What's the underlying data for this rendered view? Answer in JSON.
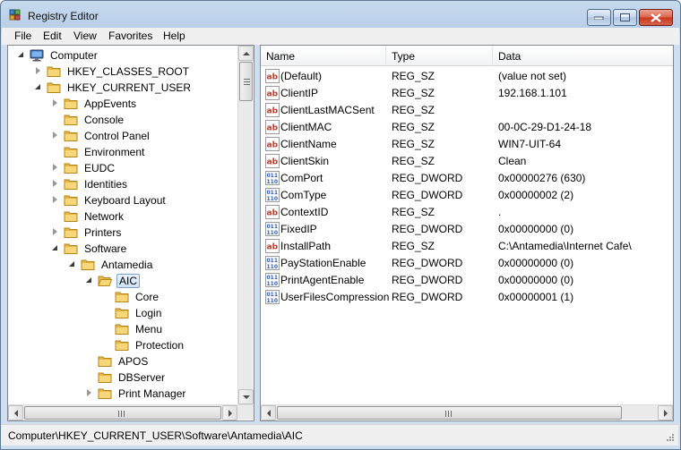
{
  "window": {
    "title": "Registry Editor"
  },
  "menu": [
    "File",
    "Edit",
    "View",
    "Favorites",
    "Help"
  ],
  "tree": [
    {
      "label": "Computer",
      "level": 0,
      "state": "open",
      "icon": "computer-icon"
    },
    {
      "label": "HKEY_CLASSES_ROOT",
      "level": 1,
      "state": "closed",
      "icon": "folder-icon"
    },
    {
      "label": "HKEY_CURRENT_USER",
      "level": 1,
      "state": "open",
      "icon": "folder-icon"
    },
    {
      "label": "AppEvents",
      "level": 2,
      "state": "closed",
      "icon": "folder-icon"
    },
    {
      "label": "Console",
      "level": 2,
      "state": "none",
      "icon": "folder-icon"
    },
    {
      "label": "Control Panel",
      "level": 2,
      "state": "closed",
      "icon": "folder-icon"
    },
    {
      "label": "Environment",
      "level": 2,
      "state": "none",
      "icon": "folder-icon"
    },
    {
      "label": "EUDC",
      "level": 2,
      "state": "closed",
      "icon": "folder-icon"
    },
    {
      "label": "Identities",
      "level": 2,
      "state": "closed",
      "icon": "folder-icon"
    },
    {
      "label": "Keyboard Layout",
      "level": 2,
      "state": "closed",
      "icon": "folder-icon"
    },
    {
      "label": "Network",
      "level": 2,
      "state": "none",
      "icon": "folder-icon"
    },
    {
      "label": "Printers",
      "level": 2,
      "state": "closed",
      "icon": "folder-icon"
    },
    {
      "label": "Software",
      "level": 2,
      "state": "open",
      "icon": "folder-icon"
    },
    {
      "label": "Antamedia",
      "level": 3,
      "state": "open",
      "icon": "folder-icon"
    },
    {
      "label": "AIC",
      "level": 4,
      "state": "open",
      "icon": "folder-open-icon",
      "selected": true
    },
    {
      "label": "Core",
      "level": 5,
      "state": "none",
      "icon": "folder-icon"
    },
    {
      "label": "Login",
      "level": 5,
      "state": "none",
      "icon": "folder-icon"
    },
    {
      "label": "Menu",
      "level": 5,
      "state": "none",
      "icon": "folder-icon"
    },
    {
      "label": "Protection",
      "level": 5,
      "state": "none",
      "icon": "folder-icon"
    },
    {
      "label": "APOS",
      "level": 4,
      "state": "none",
      "icon": "folder-icon"
    },
    {
      "label": "DBServer",
      "level": 4,
      "state": "none",
      "icon": "folder-icon"
    },
    {
      "label": "Print Manager",
      "level": 4,
      "state": "closed",
      "icon": "folder-icon"
    }
  ],
  "list": {
    "columns": [
      "Name",
      "Type",
      "Data"
    ],
    "rows": [
      {
        "icon": "string-value-icon",
        "name": "(Default)",
        "type": "REG_SZ",
        "data": "(value not set)"
      },
      {
        "icon": "string-value-icon",
        "name": "ClientIP",
        "type": "REG_SZ",
        "data": "192.168.1.101"
      },
      {
        "icon": "string-value-icon",
        "name": "ClientLastMACSent",
        "type": "REG_SZ",
        "data": ""
      },
      {
        "icon": "string-value-icon",
        "name": "ClientMAC",
        "type": "REG_SZ",
        "data": "00-0C-29-D1-24-18"
      },
      {
        "icon": "string-value-icon",
        "name": "ClientName",
        "type": "REG_SZ",
        "data": "WIN7-UIT-64"
      },
      {
        "icon": "string-value-icon",
        "name": "ClientSkin",
        "type": "REG_SZ",
        "data": "Clean"
      },
      {
        "icon": "dword-value-icon",
        "name": "ComPort",
        "type": "REG_DWORD",
        "data": "0x00000276 (630)"
      },
      {
        "icon": "dword-value-icon",
        "name": "ComType",
        "type": "REG_DWORD",
        "data": "0x00000002 (2)"
      },
      {
        "icon": "string-value-icon",
        "name": "ContextID",
        "type": "REG_SZ",
        "data": "."
      },
      {
        "icon": "dword-value-icon",
        "name": "FixedIP",
        "type": "REG_DWORD",
        "data": "0x00000000 (0)"
      },
      {
        "icon": "string-value-icon",
        "name": "InstallPath",
        "type": "REG_SZ",
        "data": "C:\\Antamedia\\Internet Cafe\\"
      },
      {
        "icon": "dword-value-icon",
        "name": "PayStationEnable",
        "type": "REG_DWORD",
        "data": "0x00000000 (0)"
      },
      {
        "icon": "dword-value-icon",
        "name": "PrintAgentEnable",
        "type": "REG_DWORD",
        "data": "0x00000000 (0)"
      },
      {
        "icon": "dword-value-icon",
        "name": "UserFilesCompression",
        "type": "REG_DWORD",
        "data": "0x00000001 (1)"
      }
    ]
  },
  "status": {
    "path": "Computer\\HKEY_CURRENT_USER\\Software\\Antamedia\\AIC"
  }
}
